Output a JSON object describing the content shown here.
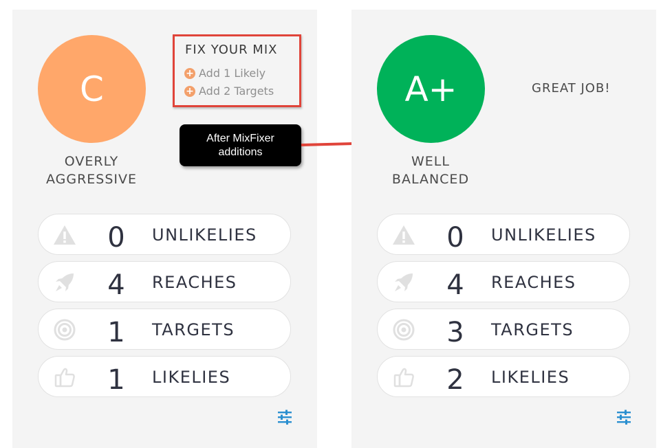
{
  "colors": {
    "grade_c": "#ffa76a",
    "grade_a_plus": "#00b259",
    "icon_gray": "#e0e0e0",
    "accent_blue": "#2a8fd0",
    "annotation_red": "#e0443a",
    "plus_orange": "#f3a06b"
  },
  "left_panel": {
    "grade": "C",
    "grade_label": [
      "OVERLY",
      "AGGRESSIVE"
    ],
    "fix_box": {
      "title": "FIX YOUR MIX",
      "items": [
        "Add 1 Likely",
        "Add 2 Targets"
      ]
    },
    "stats": [
      {
        "icon": "warning-icon",
        "value": "0",
        "label": "UNLIKELIES"
      },
      {
        "icon": "rocket-icon",
        "value": "4",
        "label": "REACHES"
      },
      {
        "icon": "target-icon",
        "value": "1",
        "label": "TARGETS"
      },
      {
        "icon": "thumbs-up-icon",
        "value": "1",
        "label": "LIKELIES"
      }
    ]
  },
  "callout": {
    "lines": [
      "After MixFixer",
      "additions"
    ]
  },
  "right_panel": {
    "grade": "A+",
    "grade_label": [
      "WELL",
      "BALANCED"
    ],
    "message": "GREAT JOB!",
    "stats": [
      {
        "icon": "warning-icon",
        "value": "0",
        "label": "UNLIKELIES"
      },
      {
        "icon": "rocket-icon",
        "value": "4",
        "label": "REACHES"
      },
      {
        "icon": "target-icon",
        "value": "3",
        "label": "TARGETS"
      },
      {
        "icon": "thumbs-up-icon",
        "value": "2",
        "label": "LIKELIES"
      }
    ]
  }
}
